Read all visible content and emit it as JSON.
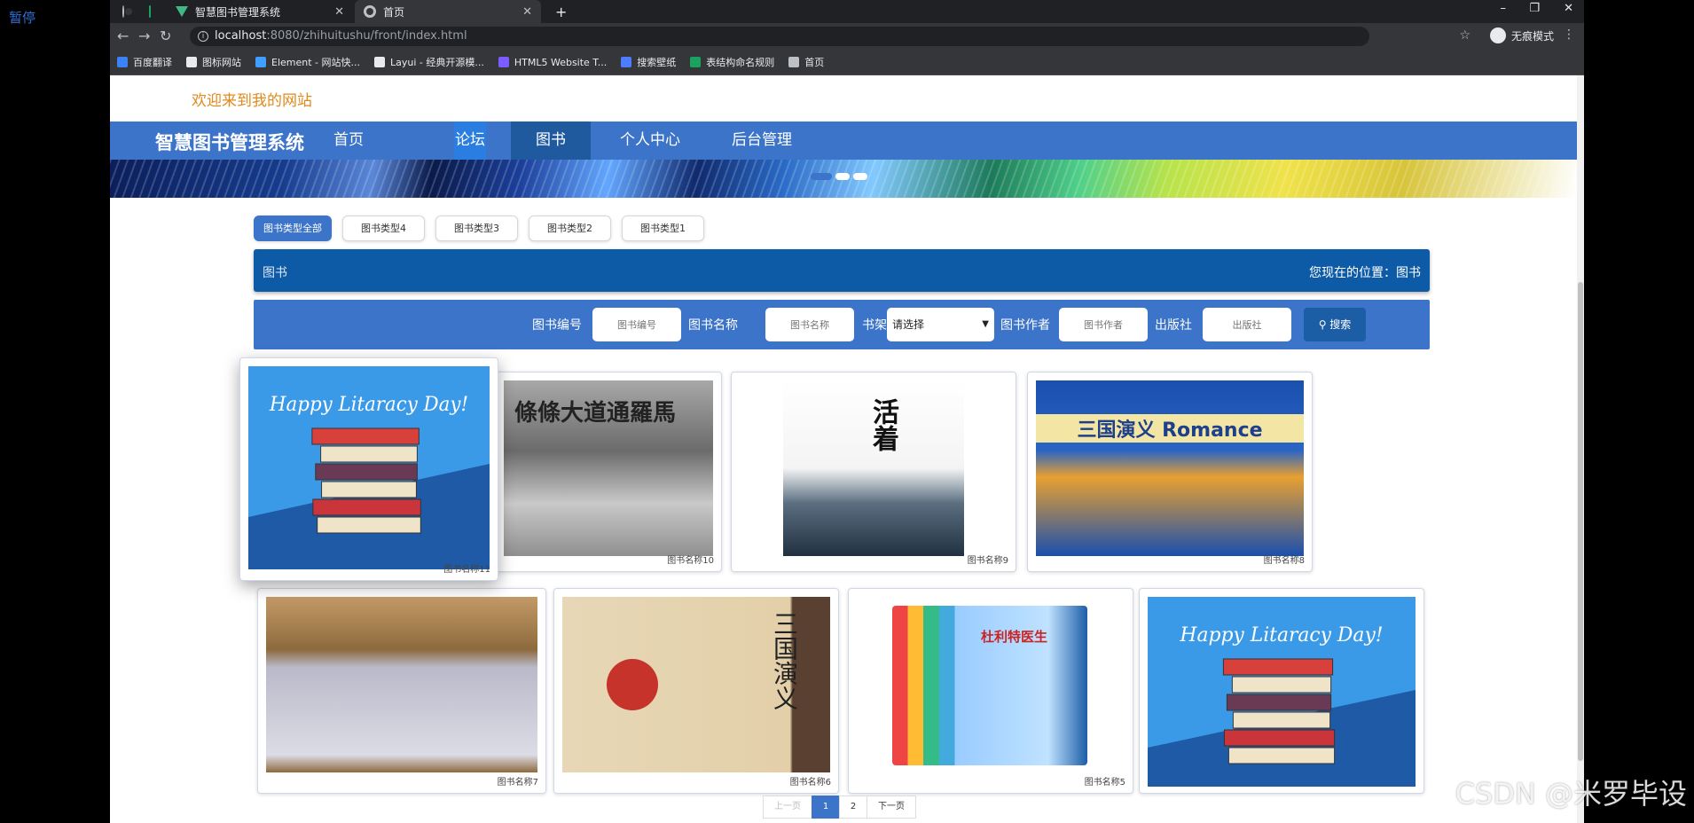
{
  "overlay": {
    "pause_label": "暂停",
    "watermark": "CSDN @米罗毕设"
  },
  "browser": {
    "tabs": [
      {
        "title": "",
        "icon": "globe-icon"
      },
      {
        "title": "",
        "icon": "app-icon"
      },
      {
        "title": "智慧图书管理系统",
        "icon": "vue-icon"
      },
      {
        "title": "首页",
        "icon": "globe-icon"
      }
    ],
    "url_host": "localhost",
    "url_path": ":8080/zhihuitushu/front/index.html",
    "incognito_label": "无痕模式",
    "bookmarks": [
      "百度翻译",
      "图标网站",
      "Element - 网站快...",
      "Layui - 经典开源模...",
      "HTML5 Website T...",
      "搜索壁纸",
      "表结构命名规则",
      "首页"
    ],
    "bookmark_colors": [
      "#3b82f6",
      "#e8eaed",
      "#409eff",
      "#e8eaed",
      "#7a5cff",
      "#4d7cff",
      "#1aa260",
      "#bdc1c6"
    ]
  },
  "site": {
    "welcome": "欢迎来到我的网站",
    "brand": "智慧图书管理系统",
    "nav": [
      "首页",
      "论坛",
      "图书",
      "个人中心",
      "后台管理"
    ],
    "active_nav": "图书"
  },
  "types": [
    "图书类型全部",
    "图书类型4",
    "图书类型3",
    "图书类型2",
    "图书类型1"
  ],
  "crumb": {
    "title": "图书",
    "location": "您现在的位置：图书"
  },
  "search": {
    "fields": [
      {
        "label": "图书编号",
        "placeholder": "图书编号"
      },
      {
        "label": "图书名称",
        "placeholder": "图书名称"
      },
      {
        "label": "书架",
        "select": "请选择"
      },
      {
        "label": "图书作者",
        "placeholder": "图书作者"
      },
      {
        "label": "出版社",
        "placeholder": "出版社"
      }
    ],
    "button": "搜索"
  },
  "books": [
    {
      "name": "图书名称11",
      "cover_text": "Happy Litaracy Day!"
    },
    {
      "name": "图书名称10",
      "cover_text": "條條大道通羅馬"
    },
    {
      "name": "图书名称9",
      "cover_text": "活着"
    },
    {
      "name": "图书名称8",
      "cover_text": "三国演义 Romance"
    },
    {
      "name": "图书名称7",
      "cover_text": ""
    },
    {
      "name": "图书名称6",
      "cover_text": "三国演义"
    },
    {
      "name": "图书名称5",
      "cover_text": "杜利特医生"
    },
    {
      "name": "",
      "cover_text": "Happy Litaracy Day!"
    }
  ],
  "pager": {
    "prev": "上一页",
    "pages": [
      "1",
      "2"
    ],
    "current": "1",
    "next": "下一页"
  },
  "colors": {
    "primary": "#3c74c9",
    "dark": "#0d5aa7",
    "welcome": "#e08a1e"
  }
}
